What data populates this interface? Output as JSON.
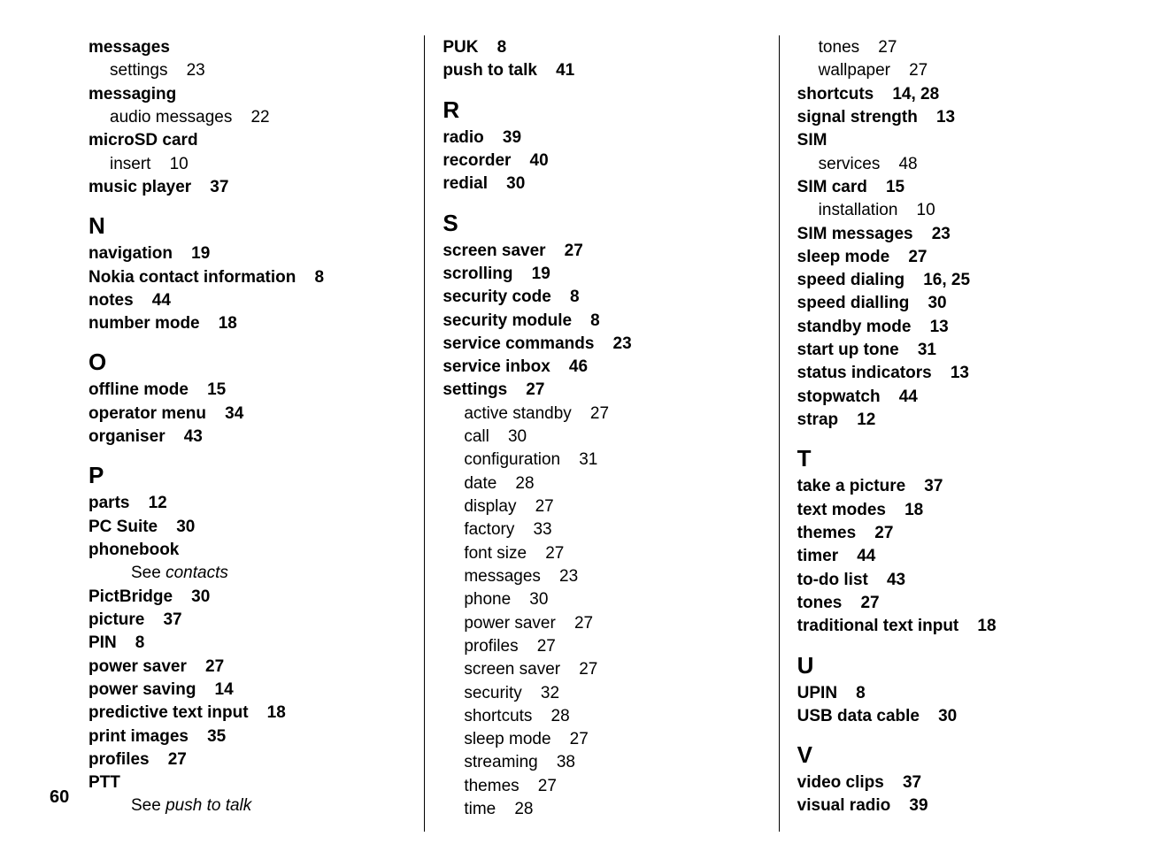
{
  "page_number": "60",
  "columns": [
    {
      "blocks": [
        {
          "type": "entry",
          "term": "messages",
          "pages": ""
        },
        {
          "type": "sub",
          "term": "settings",
          "pages": "23"
        },
        {
          "type": "entry",
          "term": "messaging",
          "pages": ""
        },
        {
          "type": "sub",
          "term": "audio messages",
          "pages": "22"
        },
        {
          "type": "entry",
          "term": "microSD card",
          "pages": ""
        },
        {
          "type": "sub",
          "term": "insert",
          "pages": "10"
        },
        {
          "type": "entry",
          "term": "music player",
          "pages": "37"
        },
        {
          "type": "letter",
          "text": "N"
        },
        {
          "type": "entry",
          "term": "navigation",
          "pages": "19"
        },
        {
          "type": "entry",
          "term": "Nokia contact information",
          "pages": "8"
        },
        {
          "type": "entry",
          "term": "notes",
          "pages": "44"
        },
        {
          "type": "entry",
          "term": "number mode",
          "pages": "18"
        },
        {
          "type": "letter",
          "text": "O"
        },
        {
          "type": "entry",
          "term": "offline mode",
          "pages": "15"
        },
        {
          "type": "entry",
          "term": "operator menu",
          "pages": "34"
        },
        {
          "type": "entry",
          "term": "organiser",
          "pages": "43"
        },
        {
          "type": "letter",
          "text": "P"
        },
        {
          "type": "entry",
          "term": "parts",
          "pages": "12"
        },
        {
          "type": "entry",
          "term": "PC Suite",
          "pages": "30"
        },
        {
          "type": "entry",
          "term": "phonebook",
          "pages": ""
        },
        {
          "type": "seeref",
          "see": "See ",
          "target": "contacts"
        },
        {
          "type": "entry",
          "term": "PictBridge",
          "pages": "30"
        },
        {
          "type": "entry",
          "term": "picture",
          "pages": "37"
        },
        {
          "type": "entry",
          "term": "PIN",
          "pages": "8"
        },
        {
          "type": "entry",
          "term": "power saver",
          "pages": "27"
        },
        {
          "type": "entry",
          "term": "power saving",
          "pages": "14"
        },
        {
          "type": "entry",
          "term": "predictive text input",
          "pages": "18"
        },
        {
          "type": "entry",
          "term": "print images",
          "pages": "35"
        },
        {
          "type": "entry",
          "term": "profiles",
          "pages": "27"
        },
        {
          "type": "entry",
          "term": "PTT",
          "pages": ""
        },
        {
          "type": "seeref",
          "see": "See ",
          "target": "push to talk"
        }
      ]
    },
    {
      "blocks": [
        {
          "type": "entry",
          "term": "PUK",
          "pages": "8"
        },
        {
          "type": "entry",
          "term": "push to talk",
          "pages": "41"
        },
        {
          "type": "letter",
          "text": "R"
        },
        {
          "type": "entry",
          "term": "radio",
          "pages": "39"
        },
        {
          "type": "entry",
          "term": "recorder",
          "pages": "40"
        },
        {
          "type": "entry",
          "term": "redial",
          "pages": "30"
        },
        {
          "type": "letter",
          "text": "S"
        },
        {
          "type": "entry",
          "term": "screen saver",
          "pages": "27"
        },
        {
          "type": "entry",
          "term": "scrolling",
          "pages": "19"
        },
        {
          "type": "entry",
          "term": "security code",
          "pages": "8"
        },
        {
          "type": "entry",
          "term": "security module",
          "pages": "8"
        },
        {
          "type": "entry",
          "term": "service commands",
          "pages": "23"
        },
        {
          "type": "entry",
          "term": "service inbox",
          "pages": "46"
        },
        {
          "type": "entry",
          "term": "settings",
          "pages": "27"
        },
        {
          "type": "sub",
          "term": "active standby",
          "pages": "27"
        },
        {
          "type": "sub",
          "term": "call",
          "pages": "30"
        },
        {
          "type": "sub",
          "term": "configuration",
          "pages": "31"
        },
        {
          "type": "sub",
          "term": "date",
          "pages": "28"
        },
        {
          "type": "sub",
          "term": "display",
          "pages": "27"
        },
        {
          "type": "sub",
          "term": "factory",
          "pages": "33"
        },
        {
          "type": "sub",
          "term": "font size",
          "pages": "27"
        },
        {
          "type": "sub",
          "term": "messages",
          "pages": "23"
        },
        {
          "type": "sub",
          "term": "phone",
          "pages": "30"
        },
        {
          "type": "sub",
          "term": "power saver",
          "pages": "27"
        },
        {
          "type": "sub",
          "term": "profiles",
          "pages": "27"
        },
        {
          "type": "sub",
          "term": "screen saver",
          "pages": "27"
        },
        {
          "type": "sub",
          "term": "security",
          "pages": "32"
        },
        {
          "type": "sub",
          "term": "shortcuts",
          "pages": "28"
        },
        {
          "type": "sub",
          "term": "sleep mode",
          "pages": "27"
        },
        {
          "type": "sub",
          "term": "streaming",
          "pages": "38"
        },
        {
          "type": "sub",
          "term": "themes",
          "pages": "27"
        },
        {
          "type": "sub",
          "term": "time",
          "pages": "28"
        }
      ]
    },
    {
      "blocks": [
        {
          "type": "sub",
          "term": "tones",
          "pages": "27"
        },
        {
          "type": "sub",
          "term": "wallpaper",
          "pages": "27"
        },
        {
          "type": "entry",
          "term": "shortcuts",
          "pages": "14, 28"
        },
        {
          "type": "entry",
          "term": "signal strength",
          "pages": "13"
        },
        {
          "type": "entry",
          "term": "SIM",
          "pages": ""
        },
        {
          "type": "sub",
          "term": "services",
          "pages": "48"
        },
        {
          "type": "entry",
          "term": "SIM card",
          "pages": "15"
        },
        {
          "type": "sub",
          "term": "installation",
          "pages": "10"
        },
        {
          "type": "entry",
          "term": "SIM messages",
          "pages": "23"
        },
        {
          "type": "entry",
          "term": "sleep mode",
          "pages": "27"
        },
        {
          "type": "entry",
          "term": "speed dialing",
          "pages": "16, 25"
        },
        {
          "type": "entry",
          "term": "speed dialling",
          "pages": "30"
        },
        {
          "type": "entry",
          "term": "standby mode",
          "pages": "13"
        },
        {
          "type": "entry",
          "term": "start up tone",
          "pages": "31"
        },
        {
          "type": "entry",
          "term": "status indicators",
          "pages": "13"
        },
        {
          "type": "entry",
          "term": "stopwatch",
          "pages": "44"
        },
        {
          "type": "entry",
          "term": "strap",
          "pages": "12"
        },
        {
          "type": "letter",
          "text": "T"
        },
        {
          "type": "entry",
          "term": "take a picture",
          "pages": "37"
        },
        {
          "type": "entry",
          "term": "text modes",
          "pages": "18"
        },
        {
          "type": "entry",
          "term": "themes",
          "pages": "27"
        },
        {
          "type": "entry",
          "term": "timer",
          "pages": "44"
        },
        {
          "type": "entry",
          "term": "to-do list",
          "pages": "43"
        },
        {
          "type": "entry",
          "term": "tones",
          "pages": "27"
        },
        {
          "type": "entry",
          "term": "traditional text input",
          "pages": "18"
        },
        {
          "type": "letter",
          "text": "U"
        },
        {
          "type": "entry",
          "term": "UPIN",
          "pages": "8"
        },
        {
          "type": "entry",
          "term": "USB data cable",
          "pages": "30"
        },
        {
          "type": "letter",
          "text": "V"
        },
        {
          "type": "entry",
          "term": "video clips",
          "pages": "37"
        },
        {
          "type": "entry",
          "term": "visual radio",
          "pages": "39"
        }
      ]
    }
  ]
}
